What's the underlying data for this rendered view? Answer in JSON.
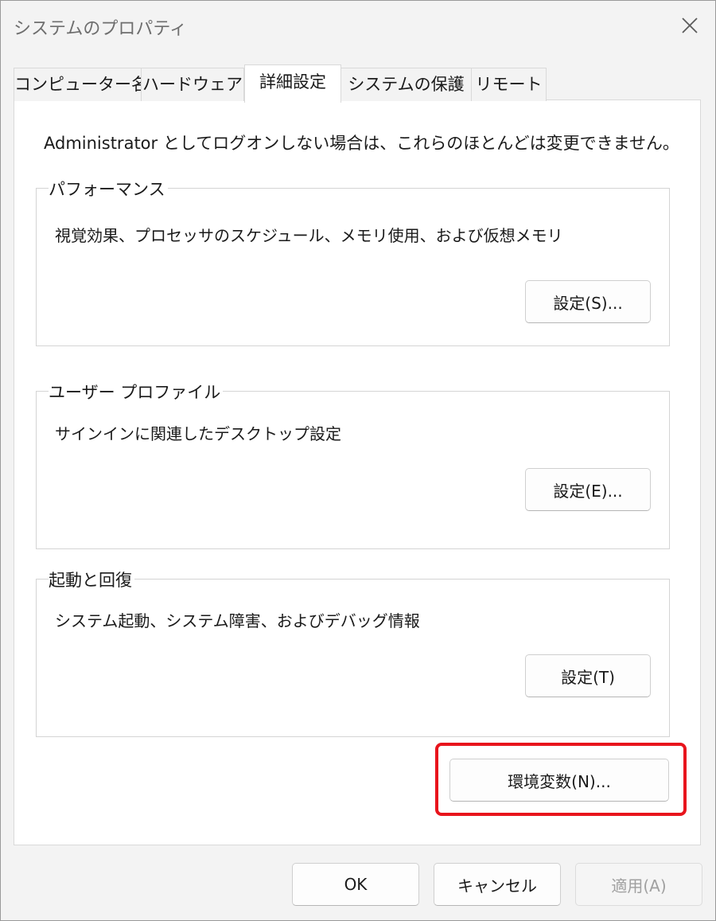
{
  "window": {
    "title": "システムのプロパティ"
  },
  "icons": {
    "close": "close-icon"
  },
  "tabs": [
    {
      "label": "コンピューター名"
    },
    {
      "label": "ハードウェア"
    },
    {
      "label": "詳細設定"
    },
    {
      "label": "システムの保護"
    },
    {
      "label": "リモート"
    }
  ],
  "advanced": {
    "admin_note": "Administrator としてログオンしない場合は、これらのほとんどは変更できません。",
    "performance": {
      "title": "パフォーマンス",
      "description": "視覚効果、プロセッサのスケジュール、メモリ使用、および仮想メモリ",
      "button": "設定(S)..."
    },
    "user_profile": {
      "title": "ユーザー プロファイル",
      "description": "サインインに関連したデスクトップ設定",
      "button": "設定(E)..."
    },
    "startup_recovery": {
      "title": "起動と回復",
      "description": "システム起動、システム障害、およびデバッグ情報",
      "button": "設定(T)"
    },
    "env_button": "環境変数(N)..."
  },
  "footer": {
    "ok": "OK",
    "cancel": "キャンセル",
    "apply": "適用(A)"
  },
  "colors": {
    "highlight": "#e8141c"
  }
}
